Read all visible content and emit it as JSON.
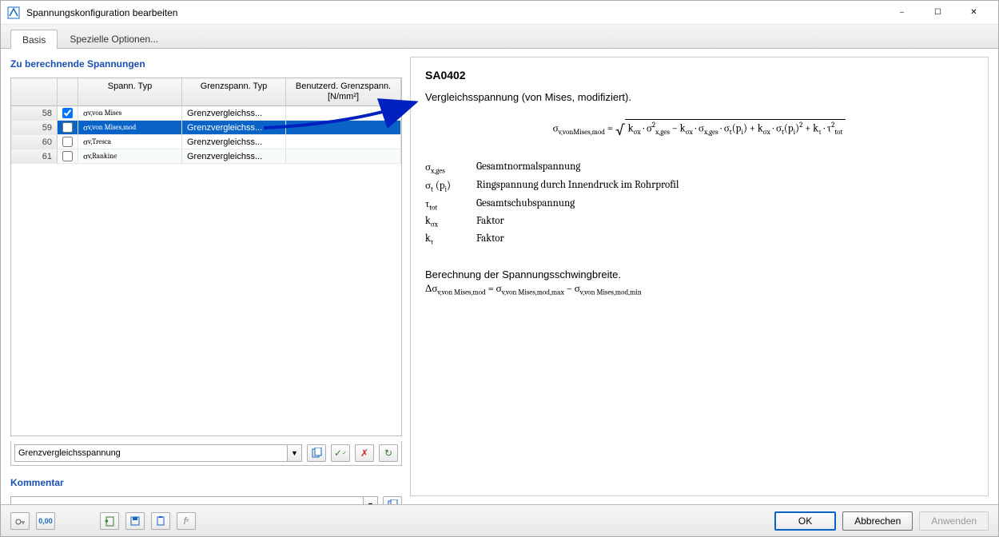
{
  "window": {
    "title": "Spannungskonfiguration bearbeiten"
  },
  "tabs": {
    "basis": "Basis",
    "special": "Spezielle Optionen..."
  },
  "sections": {
    "stresses_title": "Zu berechnende Spannungen",
    "comment_title": "Kommentar"
  },
  "columns": {
    "spann_typ": "Spann.\nTyp",
    "grenz_typ": "Grenzspann.\nTyp",
    "user_grenz": "Benutzerd. Grenzspann.\n[N/mm²]"
  },
  "rows": [
    {
      "num": "58",
      "checked": true,
      "spann": "σv,von Mises",
      "grenz": "Grenzvergleichss..."
    },
    {
      "num": "59",
      "checked": false,
      "spann": "σv,von Mises,mod",
      "grenz": "Grenzvergleichss..."
    },
    {
      "num": "60",
      "checked": false,
      "spann": "σv,Tresca",
      "grenz": "Grenzvergleichss..."
    },
    {
      "num": "61",
      "checked": false,
      "spann": "σv,Rankine",
      "grenz": "Grenzvergleichss..."
    }
  ],
  "selected_row_index": 1,
  "grenz_combo": "Grenzvergleichsspannung",
  "comment_value": "",
  "details": {
    "code": "SA0402",
    "desc": "Vergleichsspannung (von Mises, modifiziert).",
    "legend": {
      "sigma_xges": "Gesamtnormalspannung",
      "sigma_t_pi": "Ringspannung durch Innendruck im Rohrprofil",
      "tau_tot": "Gesamtschubspannung",
      "k_sigma": "Faktor",
      "k_tau": "Faktor"
    },
    "calc_title": "Berechnung der Spannungsschwingbreite."
  },
  "buttons": {
    "ok": "OK",
    "cancel": "Abbrechen",
    "apply": "Anwenden"
  }
}
